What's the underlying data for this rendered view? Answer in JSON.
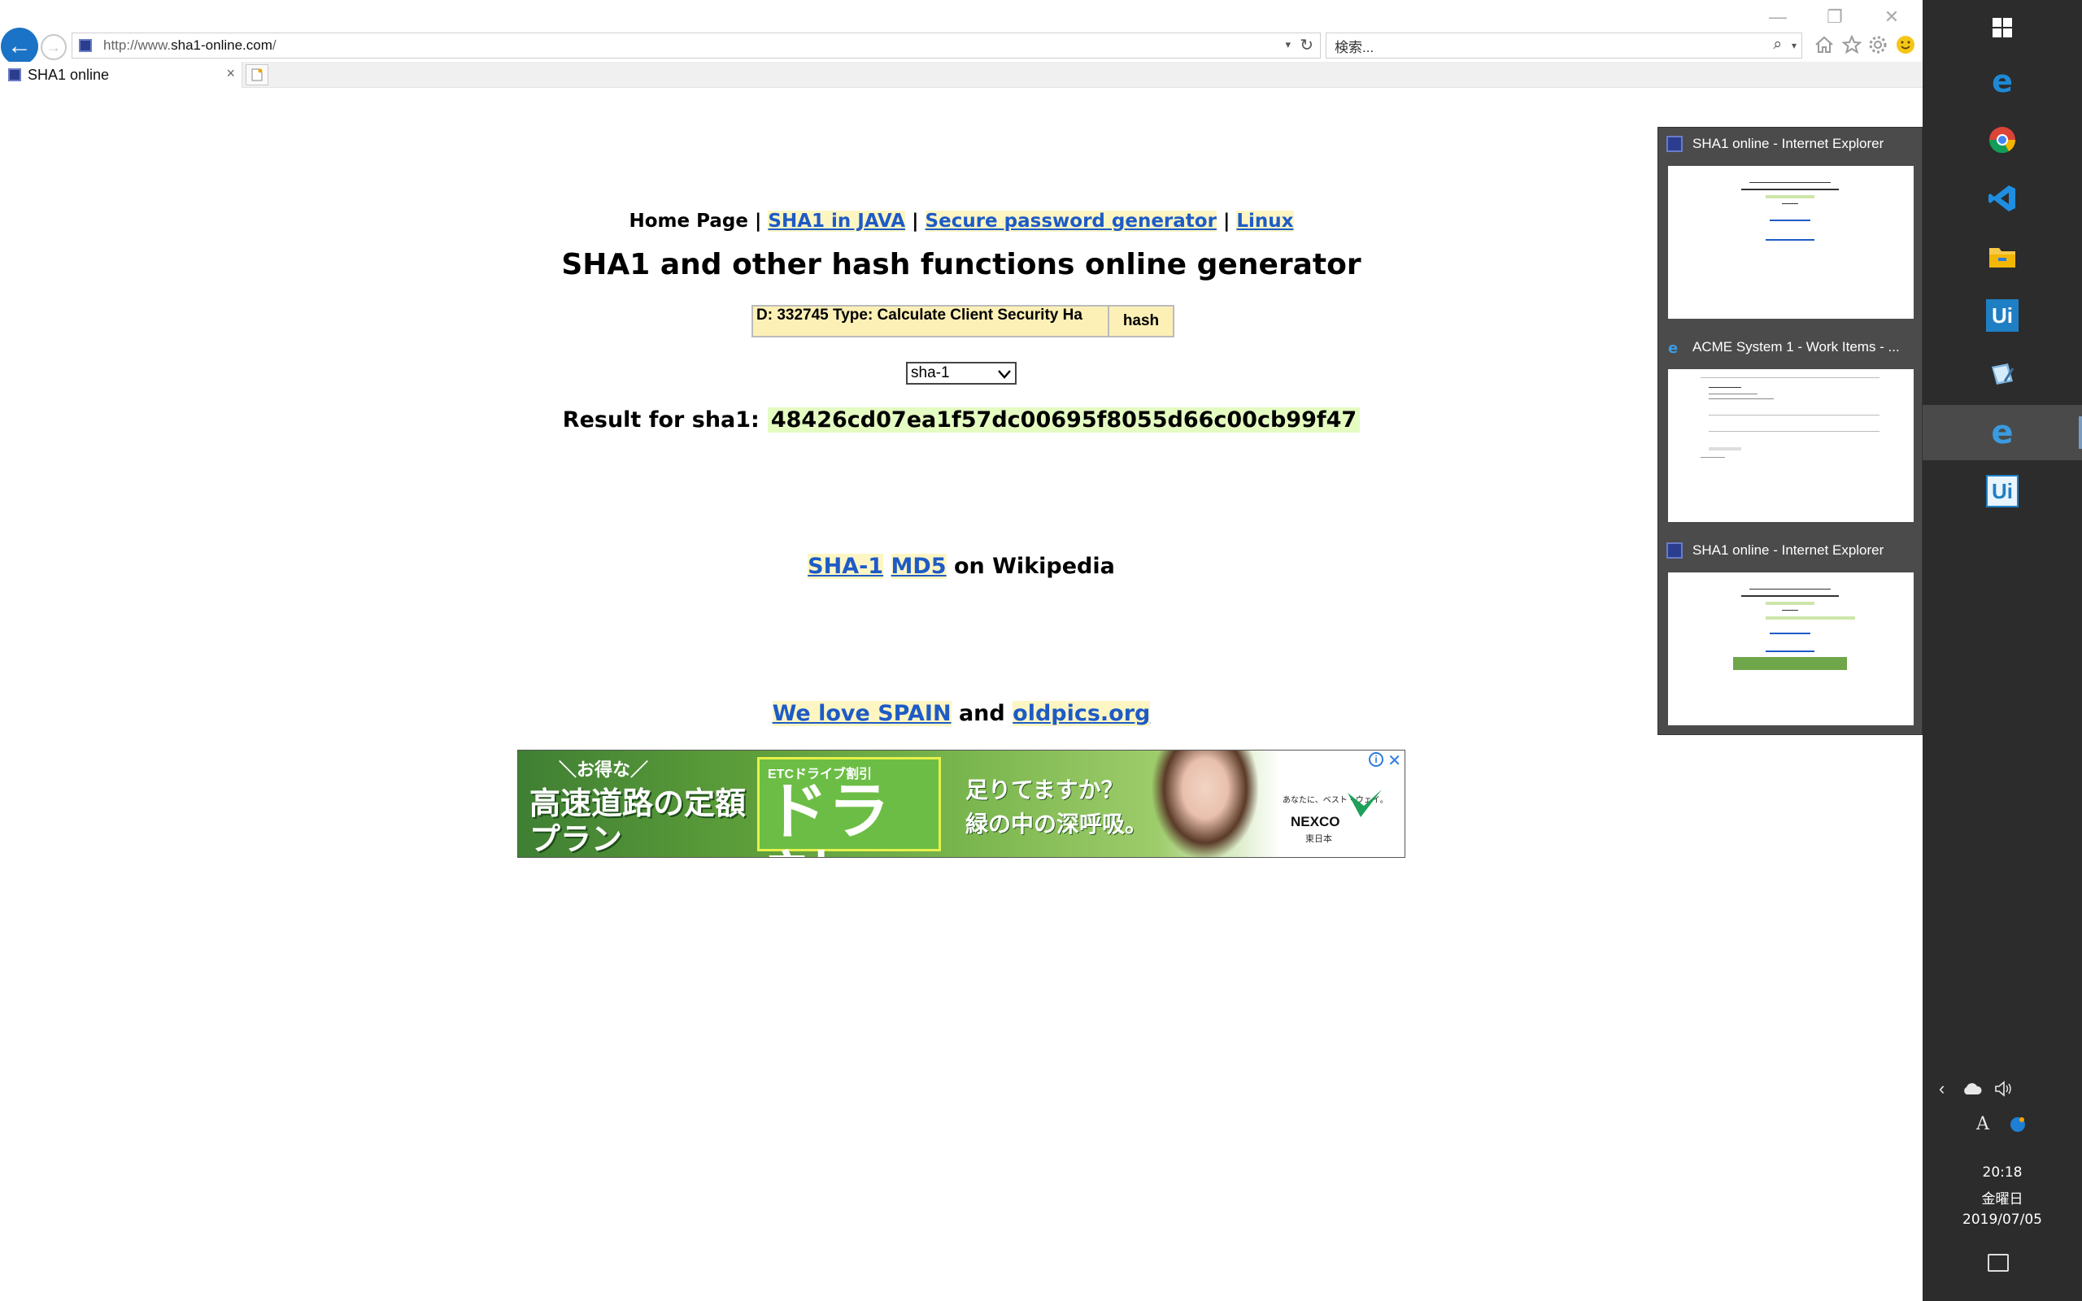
{
  "browser": {
    "address_prefix": "http://www.",
    "address_domain": "sha1-online.com",
    "address_suffix": "/",
    "search_placeholder": "検索...",
    "tab_title": "SHA1 online",
    "tab_close": "×",
    "back_glyph": "←",
    "forward_glyph": "→",
    "refresh_glyph": "↻",
    "dropdown_glyph": "▾",
    "search_glyph": "⌕",
    "window": {
      "min": "—",
      "max": "❐",
      "close": "✕"
    },
    "toolbar_icons": [
      "home-icon",
      "star-icon",
      "gear-icon",
      "smile-icon"
    ]
  },
  "page": {
    "nav": {
      "home": "Home Page",
      "sep": "|",
      "link_java": "SHA1 in JAVA",
      "link_password": "Secure password generator",
      "link_linux": "Linux"
    },
    "title": "SHA1 and other hash functions online generator",
    "input_value": "D: 332745 Type: Calculate Client Security Ha",
    "hash_button": "hash",
    "algo_selected": "sha-1",
    "result_label": "Result for sha1:",
    "result_value": "48426cd07ea1f57dc00695f8055d66c00cb99f47",
    "wiki": {
      "link_sha1": "SHA-1",
      "link_md5": "MD5",
      "suffix": "on Wikipedia"
    },
    "love": {
      "link_spain": "We love SPAIN",
      "and": "and",
      "link_oldpics": "oldpics.org"
    },
    "ad": {
      "tag": "＼お得な／",
      "headline": "高速道路の定額プラン",
      "badge_small": "ETCドライブ割引",
      "badge_big": "ドラ割",
      "copy_line1": "足りてますか？",
      "copy_line2": "緑の中の深呼吸。",
      "small_text": "あなたに、ベスト・ウェイ。",
      "logo_text": "NEXCO",
      "logo_sub": "東日本",
      "info": "i",
      "close": "✕"
    }
  },
  "thumbnails": [
    {
      "title": "SHA1 online - Internet Explorer"
    },
    {
      "title": "ACME System 1 - Work Items - ..."
    },
    {
      "title": "SHA1 online - Internet Explorer"
    }
  ],
  "taskbar": {
    "apps": [
      "windows-start-icon",
      "edge-icon",
      "chrome-icon",
      "vscode-icon",
      "file-explorer-icon",
      "uipath-studio-icon",
      "notepad-icon",
      "internet-explorer-icon",
      "uipath-robot-icon"
    ],
    "ui_label": "Ui",
    "tray_chevron": "‹",
    "ime_label": "A",
    "clock_time": "20:18",
    "clock_day": "金曜日",
    "clock_date": "2019/07/05",
    "colors": {
      "taskbar_bg": "#2c2c2c",
      "accent": "#1a73c6",
      "link": "#1e5bc6",
      "highlight": "#fdf6c3",
      "result_bg": "#e4fbc2"
    }
  }
}
